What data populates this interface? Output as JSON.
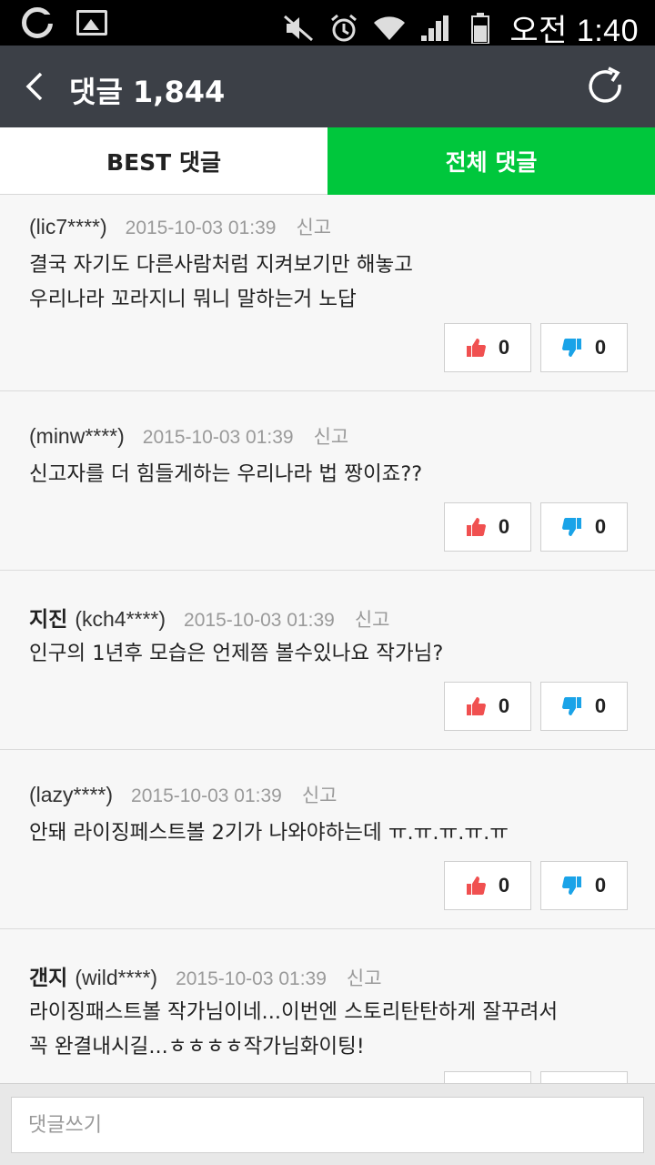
{
  "status_bar": {
    "time": "오전 1:40",
    "icons": [
      "notification-o-icon",
      "gallery-icon",
      "mute-icon",
      "alarm-icon",
      "wifi-icon",
      "signal-icon",
      "battery-icon"
    ]
  },
  "header": {
    "title": "댓글 1,844",
    "back_icon": "back-chevron-icon",
    "refresh_icon": "refresh-icon"
  },
  "tabs": [
    {
      "label": "BEST 댓글",
      "active": false
    },
    {
      "label": "전체 댓글",
      "active": true
    }
  ],
  "colors": {
    "header_bg": "#3c4047",
    "active_tab": "#00c73c",
    "like": "#f05050",
    "dislike": "#1aa3e8"
  },
  "comments": [
    {
      "nickname": "",
      "user": "(lic7****)",
      "date": "2015-10-03 01:39",
      "report": "신고",
      "lines": [
        "결국 자기도 다른사람처럼 지켜보기만 해놓고",
        "우리나라 꼬라지니 뭐니 말하는거 노답"
      ],
      "likes": "0",
      "dislikes": "0"
    },
    {
      "nickname": "",
      "user": "(minw****)",
      "date": "2015-10-03 01:39",
      "report": "신고",
      "lines": [
        "신고자를 더 힘들게하는 우리나라 법 짱이죠??"
      ],
      "likes": "0",
      "dislikes": "0"
    },
    {
      "nickname": "지진",
      "user": "(kch4****)",
      "date": "2015-10-03 01:39",
      "report": "신고",
      "lines": [
        "인구의 1년후 모습은 언제쯤 볼수있나요 작가님?"
      ],
      "likes": "0",
      "dislikes": "0"
    },
    {
      "nickname": "",
      "user": "(lazy****)",
      "date": "2015-10-03 01:39",
      "report": "신고",
      "lines": [
        "안돼 라이징페스트볼 2기가 나와야하는데 ㅠ.ㅠ.ㅠ.ㅠ.ㅠ"
      ],
      "likes": "0",
      "dislikes": "0"
    },
    {
      "nickname": "갠지",
      "user": "(wild****)",
      "date": "2015-10-03 01:39",
      "report": "신고",
      "lines": [
        "라이징패스트볼 작가님이네...이번엔 스토리탄탄하게 잘꾸려서",
        "꼭 완결내시길...ㅎㅎㅎㅎ작가님화이팅!"
      ],
      "likes": "",
      "dislikes": ""
    }
  ],
  "input": {
    "placeholder": "댓글쓰기"
  }
}
